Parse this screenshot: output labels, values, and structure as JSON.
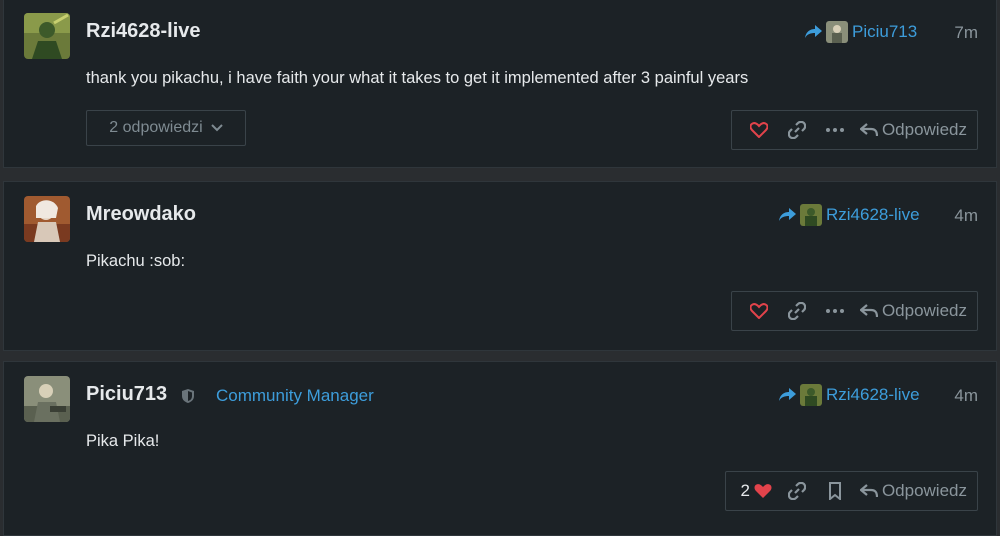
{
  "colors": {
    "accent": "#3d9ddb",
    "heart": "#e2434b",
    "background": "#1c2226"
  },
  "posts": [
    {
      "username": "Rzi4628-live",
      "reply_to": "Piciu713",
      "time": "7m",
      "body": "thank you pikachu, i have faith your what it takes to get it implemented after 3 painful years",
      "replies_label": "2 odpowiedzi",
      "reply_label": "Odpowiedz",
      "icons": [
        "heart-icon",
        "link-icon",
        "more-icon",
        "reply-icon"
      ]
    },
    {
      "username": "Mreowdako",
      "reply_to": "Rzi4628-live",
      "time": "4m",
      "body": "Pikachu :sob:",
      "reply_label": "Odpowiedz",
      "icons": [
        "heart-icon",
        "link-icon",
        "more-icon",
        "reply-icon"
      ]
    },
    {
      "username": "Piciu713",
      "role": "Community Manager",
      "reply_to": "Rzi4628-live",
      "time": "4m",
      "body": "Pika Pika!",
      "like_count": "2",
      "reply_label": "Odpowiedz",
      "icons": [
        "shield-icon",
        "heart-icon",
        "link-icon",
        "bookmark-icon",
        "reply-icon"
      ]
    }
  ]
}
